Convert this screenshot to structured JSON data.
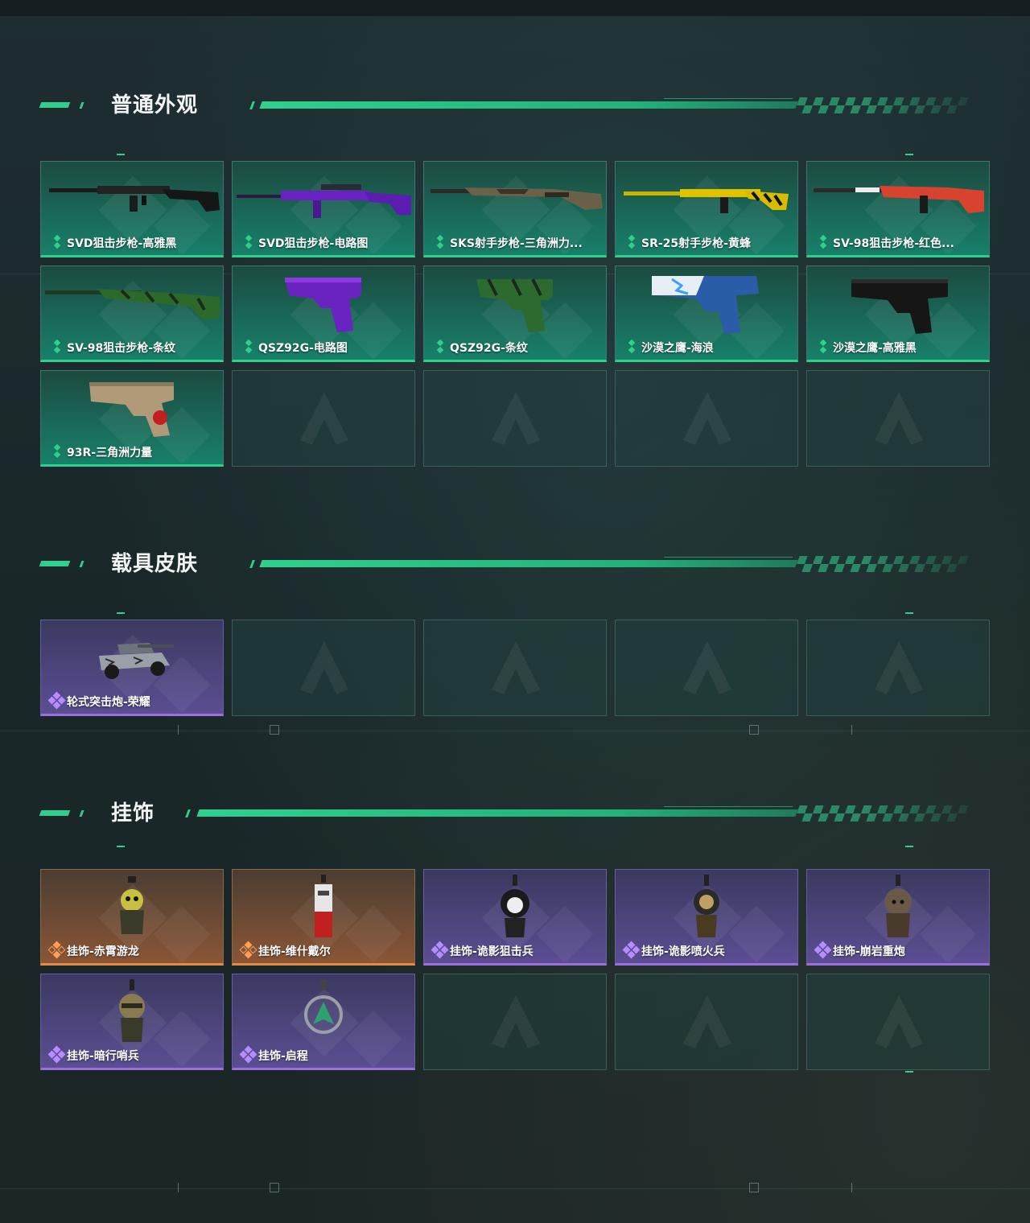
{
  "sections": [
    {
      "title": "普通外观",
      "items": [
        {
          "label": "SVD狙击步枪-高雅黑",
          "rarity": "green",
          "icon": "rifle-icon"
        },
        {
          "label": "SVD狙击步枪-电路图",
          "rarity": "green",
          "icon": "rifle-icon"
        },
        {
          "label": "SKS射手步枪-三角洲力...",
          "rarity": "green",
          "icon": "rifle-icon"
        },
        {
          "label": "SR-25射手步枪-黄蜂",
          "rarity": "green",
          "icon": "rifle-icon"
        },
        {
          "label": "SV-98狙击步枪-红色...",
          "rarity": "green",
          "icon": "rifle-icon"
        },
        {
          "label": "SV-98狙击步枪-条纹",
          "rarity": "green",
          "icon": "rifle-icon"
        },
        {
          "label": "QSZ92G-电路图",
          "rarity": "green",
          "icon": "pistol-icon"
        },
        {
          "label": "QSZ92G-条纹",
          "rarity": "green",
          "icon": "pistol-icon"
        },
        {
          "label": "沙漠之鹰-海浪",
          "rarity": "green",
          "icon": "pistol-icon"
        },
        {
          "label": "沙漠之鹰-高雅黑",
          "rarity": "green",
          "icon": "pistol-icon"
        },
        {
          "label": "93R-三角洲力量",
          "rarity": "green",
          "icon": "pistol-icon"
        }
      ]
    },
    {
      "title": "载具皮肤",
      "items": [
        {
          "label": "轮式突击炮-荣耀",
          "rarity": "purple",
          "icon": "vehicle-icon"
        }
      ]
    },
    {
      "title": "挂饰",
      "items": [
        {
          "label": "挂饰-赤霄游龙",
          "rarity": "orange",
          "icon": "charm-icon"
        },
        {
          "label": "挂饰-维什戴尔",
          "rarity": "orange",
          "icon": "charm-icon"
        },
        {
          "label": "挂饰-诡影狙击兵",
          "rarity": "purple",
          "icon": "charm-icon"
        },
        {
          "label": "挂饰-诡影喷火兵",
          "rarity": "purple",
          "icon": "charm-icon"
        },
        {
          "label": "挂饰-崩岩重炮",
          "rarity": "purple",
          "icon": "charm-icon"
        },
        {
          "label": "挂饰-暗行哨兵",
          "rarity": "purple",
          "icon": "charm-icon"
        },
        {
          "label": "挂饰-启程",
          "rarity": "purple",
          "icon": "charm-icon"
        }
      ]
    }
  ],
  "colors": {
    "accent": "#2fd08c",
    "purple": "#9a70e0",
    "orange": "#e58a44",
    "background": "#1b2a2c"
  }
}
